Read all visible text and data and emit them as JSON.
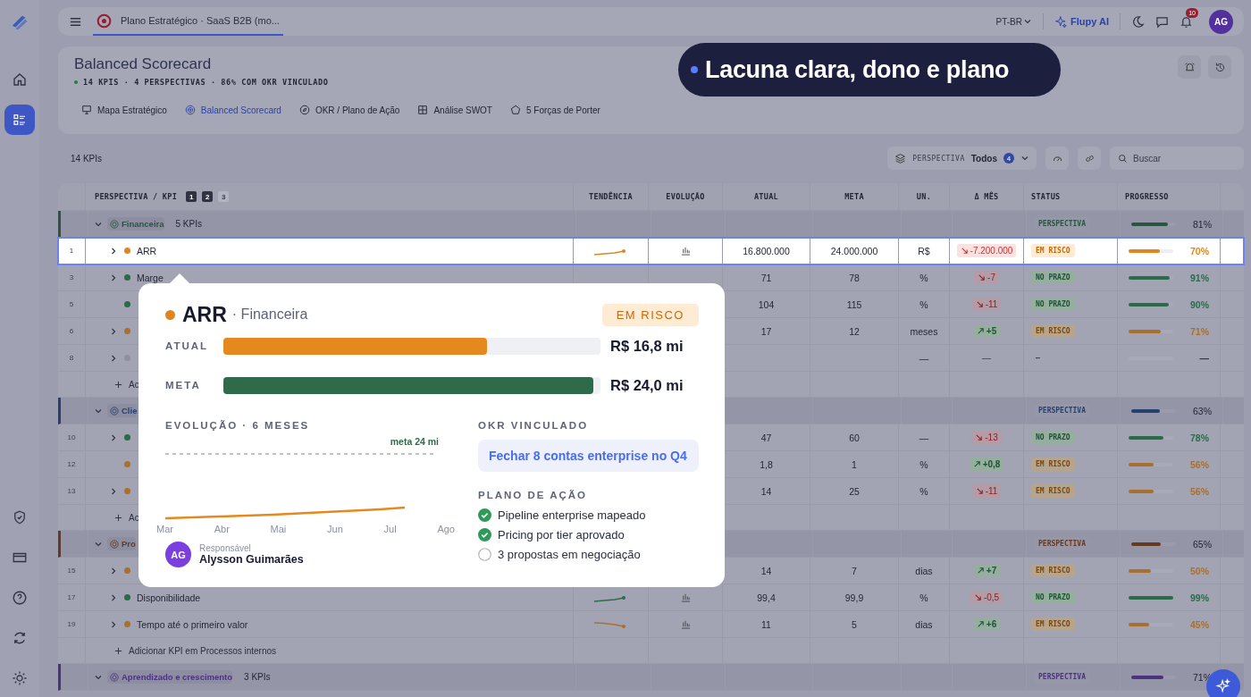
{
  "sidebar": {
    "items": [
      {
        "selected": false
      },
      {
        "selected": true
      }
    ],
    "bottom_items": [
      {
        "selected": false
      },
      {
        "selected": false
      },
      {
        "selected": false
      },
      {
        "selected": false
      },
      {
        "selected": false
      }
    ]
  },
  "topbar": {
    "tab": {
      "title": "Plano Estratégico · SaaS B2B (mo...",
      "selected": true
    },
    "language": "PT-BR",
    "ai_button": "Flupy AI",
    "notifications_badge": "10",
    "avatar": "AG"
  },
  "caption": "Lacuna clara, dono e plano",
  "header": {
    "title": "Balanced Scorecard",
    "summary": "14 KPIS · 4 PERSPECTIVAS · 86% COM OKR VINCULADO",
    "tabs": [
      {
        "label": "Mapa Estratégico",
        "selected": false
      },
      {
        "label": "Balanced Scorecard",
        "selected": true
      },
      {
        "label": "OKR / Plano de Ação",
        "selected": false
      },
      {
        "label": "Análise SWOT",
        "selected": false
      },
      {
        "label": "5 Forças de Porter",
        "selected": false
      }
    ]
  },
  "toolbar": {
    "count": "14 KPIs",
    "filter_label": "PERSPECTIVA",
    "filter_value": "Todos",
    "filter_badge": "4",
    "search": {
      "placeholder": "Buscar"
    }
  },
  "table": {
    "columns": [
      "PERSPECTIVA / KPI",
      "TENDÊNCIA",
      "EVOLUÇÃO",
      "ATUAL",
      "META",
      "UN.",
      "Δ MÊS",
      "STATUS",
      "PROGRESSO"
    ],
    "levels": [
      {
        "label": "1",
        "selected": true
      },
      {
        "label": "2",
        "selected": true
      },
      {
        "label": "3",
        "selected": false
      }
    ],
    "rows": [
      {
        "kind": "group",
        "name": "Financeira",
        "count": "5 KPIs",
        "status": "PERSPECTIVA",
        "level": 0.81,
        "progress": "81%",
        "color": "#2a5543"
      },
      {
        "kind": "kpi",
        "number": "1",
        "selected": true,
        "expandable": true,
        "color": "#e0861d",
        "name": "ARR",
        "trend_up": true,
        "chart_icon": true,
        "actual": "16.800.000",
        "target": "24.000.000",
        "unit": "R$",
        "delta": {
          "text": "-7.200.000",
          "kind": "down"
        },
        "status": {
          "text": "EM RISCO",
          "kind": "risk"
        },
        "level": 0.7,
        "progress": "70%"
      },
      {
        "kind": "kpi",
        "number": "3",
        "selected": false,
        "expandable": true,
        "color": "#2b6b49",
        "name": "Marge",
        "actual": "71",
        "target": "78",
        "unit": "%",
        "delta": {
          "text": "-7",
          "kind": "down"
        },
        "status": {
          "text": "NO PRAZO",
          "kind": "ok"
        },
        "level": 0.91,
        "progress": "91%"
      },
      {
        "kind": "kpi",
        "number": "5",
        "selected": false,
        "expandable": false,
        "color": "#2b6b49",
        "actual": "104",
        "target": "115",
        "unit": "%",
        "delta": {
          "text": "-11",
          "kind": "down"
        },
        "status": {
          "text": "NO PRAZO",
          "kind": "ok"
        },
        "level": 0.9,
        "progress": "90%"
      },
      {
        "kind": "kpi",
        "number": "6",
        "selected": false,
        "expandable": true,
        "color": "#a8702c",
        "actual": "17",
        "target": "12",
        "unit": "meses",
        "delta": {
          "text": "+5",
          "kind": "up"
        },
        "status": {
          "text": "EM RISCO",
          "kind": "risk"
        },
        "level": 0.71,
        "progress": "71%"
      },
      {
        "kind": "kpi",
        "number": "8",
        "selected": false,
        "expandable": true,
        "color": "#8e909e",
        "unit": "—",
        "delta": {
          "text": "—",
          "kind": "none"
        },
        "status": {
          "text": "—",
          "kind": "none"
        },
        "level": 0,
        "progress": "—"
      },
      {
        "kind": "add",
        "label": "Ac"
      },
      {
        "kind": "group",
        "name": "Clie",
        "status": "PERSPECTIVA",
        "level": 0.63,
        "progress": "63%",
        "color": "#253f70"
      },
      {
        "kind": "kpi",
        "number": "10",
        "selected": false,
        "expandable": true,
        "color": "#2b6b49",
        "actual": "47",
        "target": "60",
        "unit": "—",
        "delta": {
          "text": "-13",
          "kind": "down"
        },
        "status": {
          "text": "NO PRAZO",
          "kind": "ok"
        },
        "level": 0.78,
        "progress": "78%"
      },
      {
        "kind": "kpi",
        "number": "12",
        "selected": false,
        "expandable": false,
        "color": "#a8702c",
        "actual": "1,8",
        "target": "1",
        "unit": "%",
        "delta": {
          "text": "+0,8",
          "kind": "up"
        },
        "status": {
          "text": "EM RISCO",
          "kind": "risk"
        },
        "level": 0.56,
        "progress": "56%"
      },
      {
        "kind": "kpi",
        "number": "13",
        "selected": false,
        "expandable": true,
        "color": "#a8702c",
        "actual": "14",
        "target": "25",
        "unit": "%",
        "delta": {
          "text": "-11",
          "kind": "down"
        },
        "status": {
          "text": "EM RISCO",
          "kind": "risk"
        },
        "level": 0.56,
        "progress": "56%"
      },
      {
        "kind": "add",
        "label": "Ac"
      },
      {
        "kind": "group",
        "name": "Pro",
        "status": "PERSPECTIVA",
        "level": 0.65,
        "progress": "65%",
        "color": "#653a22"
      },
      {
        "kind": "kpi",
        "number": "15",
        "selected": false,
        "expandable": true,
        "color": "#a8702c",
        "actual": "14",
        "target": "7",
        "unit": "dias",
        "delta": {
          "text": "+7",
          "kind": "up"
        },
        "status": {
          "text": "EM RISCO",
          "kind": "risk"
        },
        "level": 0.5,
        "progress": "50%"
      },
      {
        "kind": "kpi",
        "number": "17",
        "selected": false,
        "expandable": true,
        "color": "#2b6b49",
        "name": "Disponibilidade",
        "trend_up": true,
        "chart_icon": true,
        "actual": "99,4",
        "target": "99,9",
        "unit": "%",
        "delta": {
          "text": "-0,5",
          "kind": "down"
        },
        "status": {
          "text": "NO PRAZO",
          "kind": "ok"
        },
        "level": 0.99,
        "progress": "99%"
      },
      {
        "kind": "kpi",
        "number": "19",
        "selected": false,
        "expandable": true,
        "color": "#a8702c",
        "name": "Tempo até o primeiro valor",
        "trend_up": false,
        "chart_icon": true,
        "actual": "11",
        "target": "5",
        "unit": "dias",
        "delta": {
          "text": "+6",
          "kind": "up"
        },
        "status": {
          "text": "EM RISCO",
          "kind": "risk"
        },
        "level": 0.45,
        "progress": "45%"
      },
      {
        "kind": "add",
        "label": "Adicionar KPI em Processos internos"
      },
      {
        "kind": "group",
        "name": "Aprendizado e crescimento",
        "count": "3 KPIs",
        "status": "PERSPECTIVA",
        "level": 0.71,
        "progress": "71%",
        "color": "#4b3180"
      }
    ]
  },
  "popup": {
    "title": "ARR",
    "perspective": "· Financeira",
    "status": {
      "text": "EM RISCO",
      "kind": "risk"
    },
    "bars": [
      {
        "label": "ATUAL",
        "kind": "actual",
        "level": 0.7,
        "value": "R$ 16,8 mi"
      },
      {
        "label": "META",
        "kind": "target",
        "level": 0.98,
        "value": "R$ 24,0 mi"
      }
    ],
    "evolution": {
      "title": "EVOLUÇÃO · 6 MESES",
      "target_label": "meta 24 mi",
      "months": [
        "Mar",
        "Abr",
        "Mai",
        "Jun",
        "Jul",
        "Ago"
      ]
    },
    "owner": {
      "label": "Responsável",
      "initials": "AG",
      "name": "Alysson Guimarães"
    },
    "okr": {
      "title": "OKR VINCULADO",
      "link": "Fechar 8 contas enterprise no Q4"
    },
    "plan": {
      "title": "PLANO DE AÇÃO",
      "items": [
        {
          "text": "Pipeline enterprise mapeado",
          "checked": true
        },
        {
          "text": "Pricing por tier aprovado",
          "checked": true
        },
        {
          "text": "3 propostas em negociação",
          "checked": false
        }
      ]
    }
  }
}
